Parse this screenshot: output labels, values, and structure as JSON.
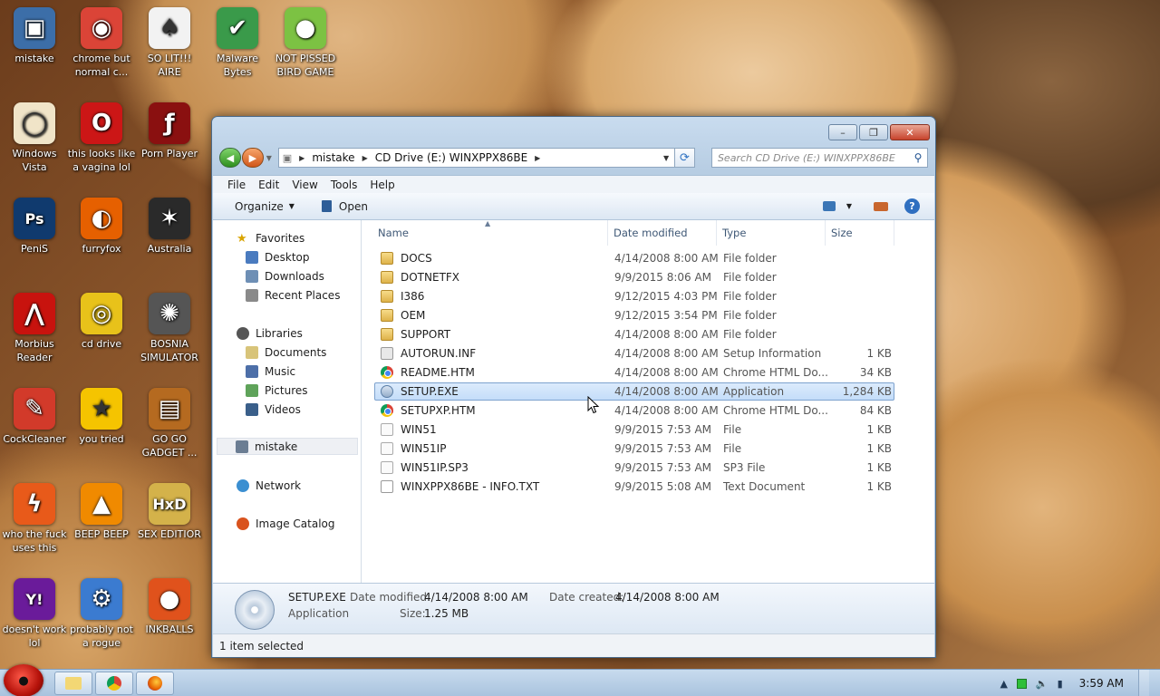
{
  "desktop": {
    "icons": [
      {
        "label": "mistake",
        "icon": "computer-icon",
        "color": "#3c6ea8"
      },
      {
        "label": "chrome but normal c...",
        "icon": "chrome-icon",
        "color": "#db4437"
      },
      {
        "label": "SO LIT!!! AIRE",
        "icon": "cards-icon",
        "color": "#f2f2f2"
      },
      {
        "label": "Malware Bytes",
        "icon": "shield-icon",
        "color": "#3a9a4a"
      },
      {
        "label": "NOT PISSED BIRD GAME",
        "icon": "pig-icon",
        "color": "#7cc243"
      },
      {
        "label": "Windows Vista",
        "icon": "egg-icon",
        "color": "#f0e4c8"
      },
      {
        "label": "this looks like a vagina lol",
        "icon": "opera-icon",
        "color": "#cc1616"
      },
      {
        "label": "Porn Player",
        "icon": "flash-icon",
        "color": "#8a1010"
      },
      {
        "label": "PeniS",
        "icon": "photoshop-icon",
        "color": "#103a6e"
      },
      {
        "label": "furryfox",
        "icon": "firefox-icon",
        "color": "#e66000"
      },
      {
        "label": "Australia",
        "icon": "spider-icon",
        "color": "#2a2a2a"
      },
      {
        "label": "Morbius Reader",
        "icon": "pdf-icon",
        "color": "#c8130e"
      },
      {
        "label": "cd drive",
        "icon": "cd-icon",
        "color": "#e8c21a"
      },
      {
        "label": "BOSNIA SIMULATOR",
        "icon": "mine-icon",
        "color": "#555555"
      },
      {
        "label": "CockCleaner",
        "icon": "broom-icon",
        "color": "#d23a2a"
      },
      {
        "label": "you tried",
        "icon": "star-icon",
        "color": "#f5c400"
      },
      {
        "label": "GO GO GADGET ...",
        "icon": "briefcase-icon",
        "color": "#b56a20"
      },
      {
        "label": "who the fuck uses this",
        "icon": "lightning-icon",
        "color": "#e85a1a"
      },
      {
        "label": "BEEP BEEP",
        "icon": "vlc-icon",
        "color": "#f08a00"
      },
      {
        "label": "SEX EDITIOR",
        "icon": "hxd-icon",
        "color": "#d4b24a"
      },
      {
        "label": "doesn't work lol",
        "icon": "yahoo-icon",
        "color": "#6a1b9a"
      },
      {
        "label": "probably not a rogue",
        "icon": "gears-icon",
        "color": "#3b7bd0"
      },
      {
        "label": "INKBALLS",
        "icon": "ball-icon",
        "color": "#e0521c"
      }
    ]
  },
  "window": {
    "buttons": {
      "minimize": "–",
      "maximize": "❐",
      "close": "✕"
    },
    "address": {
      "crumbs": [
        "mistake",
        "CD Drive (E:) WINXPPX86BE"
      ]
    },
    "search_placeholder": "Search CD Drive (E:) WINXPPX86BE",
    "menu": [
      "File",
      "Edit",
      "View",
      "Tools",
      "Help"
    ],
    "toolbar": {
      "organize": "Organize",
      "open": "Open",
      "help": "?"
    },
    "nav": {
      "favorites": "Favorites",
      "desktop": "Desktop",
      "downloads": "Downloads",
      "recent": "Recent Places",
      "libraries": "Libraries",
      "documents": "Documents",
      "music": "Music",
      "pictures": "Pictures",
      "videos": "Videos",
      "homegroup": "mistake",
      "network": "Network",
      "image_catalog": "Image Catalog"
    },
    "columns": {
      "name": "Name",
      "date": "Date modified",
      "type": "Type",
      "size": "Size"
    },
    "files": [
      {
        "name": "DOCS",
        "date": "4/14/2008 8:00 AM",
        "type": "File folder",
        "size": "",
        "icon": "folder-icon"
      },
      {
        "name": "DOTNETFX",
        "date": "9/9/2015 8:06 AM",
        "type": "File folder",
        "size": "",
        "icon": "folder-icon"
      },
      {
        "name": "I386",
        "date": "9/12/2015 4:03 PM",
        "type": "File folder",
        "size": "",
        "icon": "folder-icon"
      },
      {
        "name": "OEM",
        "date": "9/12/2015 3:54 PM",
        "type": "File folder",
        "size": "",
        "icon": "folder-icon"
      },
      {
        "name": "SUPPORT",
        "date": "4/14/2008 8:00 AM",
        "type": "File folder",
        "size": "",
        "icon": "folder-icon"
      },
      {
        "name": "AUTORUN.INF",
        "date": "4/14/2008 8:00 AM",
        "type": "Setup Information",
        "size": "1 KB",
        "icon": "inf-icon"
      },
      {
        "name": "README.HTM",
        "date": "4/14/2008 8:00 AM",
        "type": "Chrome HTML Do...",
        "size": "34 KB",
        "icon": "chrome-icon"
      },
      {
        "name": "SETUP.EXE",
        "date": "4/14/2008 8:00 AM",
        "type": "Application",
        "size": "1,284 KB",
        "icon": "exe-icon",
        "selected": true
      },
      {
        "name": "SETUPXP.HTM",
        "date": "4/14/2008 8:00 AM",
        "type": "Chrome HTML Do...",
        "size": "84 KB",
        "icon": "chrome-icon"
      },
      {
        "name": "WIN51",
        "date": "9/9/2015 7:53 AM",
        "type": "File",
        "size": "1 KB",
        "icon": "file-icon"
      },
      {
        "name": "WIN51IP",
        "date": "9/9/2015 7:53 AM",
        "type": "File",
        "size": "1 KB",
        "icon": "file-icon"
      },
      {
        "name": "WIN51IP.SP3",
        "date": "9/9/2015 7:53 AM",
        "type": "SP3 File",
        "size": "1 KB",
        "icon": "file-icon"
      },
      {
        "name": "WINXPPX86BE - INFO.TXT",
        "date": "9/9/2015 5:08 AM",
        "type": "Text Document",
        "size": "1 KB",
        "icon": "txt-icon"
      }
    ],
    "details": {
      "name": "SETUP.EXE",
      "type": "Application",
      "modified_label": "Date modified:",
      "modified_value": "4/14/2008 8:00 AM",
      "created_label": "Date created:",
      "created_value": "4/14/2008 8:00 AM",
      "size_label": "Size:",
      "size_value": "1.25 MB"
    },
    "status": "1 item selected"
  },
  "taskbar": {
    "clock": "3:59 AM"
  }
}
